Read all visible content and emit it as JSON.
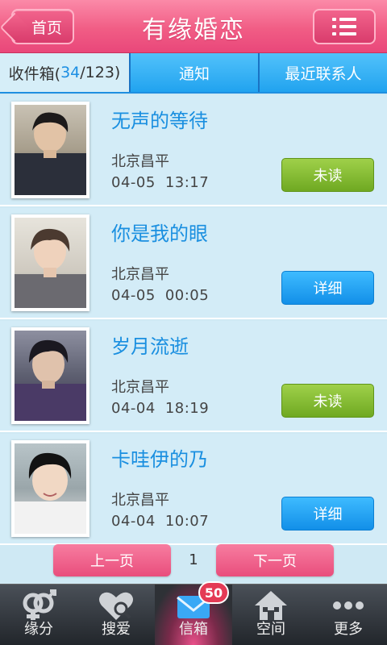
{
  "header": {
    "back_label": "首页",
    "title": "有缘婚恋",
    "menu_icon": "list-icon"
  },
  "tabs": {
    "inbox_label": "收件箱(",
    "inbox_unread": "34",
    "inbox_total": "/123)",
    "notice": "通知",
    "recent": "最近联系人"
  },
  "messages": [
    {
      "name": "无声的等待",
      "location": "北京昌平",
      "date": "04-05",
      "time": "13:17",
      "action": "未读",
      "status": "unread"
    },
    {
      "name": "你是我的眼",
      "location": "北京昌平",
      "date": "04-05",
      "time": "00:05",
      "action": "详细",
      "status": "read"
    },
    {
      "name": "岁月流逝",
      "location": "北京昌平",
      "date": "04-04",
      "time": "18:19",
      "action": "未读",
      "status": "unread"
    },
    {
      "name": "卡哇伊的乃",
      "location": "北京昌平",
      "date": "04-04",
      "time": "10:07",
      "action": "详细",
      "status": "read"
    }
  ],
  "pager": {
    "prev": "上一页",
    "current": "1",
    "next": "下一页"
  },
  "nav": [
    {
      "label": "缘分",
      "icon": "gender-icon"
    },
    {
      "label": "搜爱",
      "icon": "heart-search-icon"
    },
    {
      "label": "信箱",
      "icon": "mail-icon",
      "badge": "50"
    },
    {
      "label": "空间",
      "icon": "home-icon"
    },
    {
      "label": "更多",
      "icon": "more-icon"
    }
  ],
  "colors": {
    "header_pink": "#f15d85",
    "tab_blue": "#21a3ef",
    "name_blue": "#1a8fe0",
    "unread_green": "#7bb52a",
    "detail_blue": "#1b98ec",
    "list_bg": "#d3ecf7"
  }
}
